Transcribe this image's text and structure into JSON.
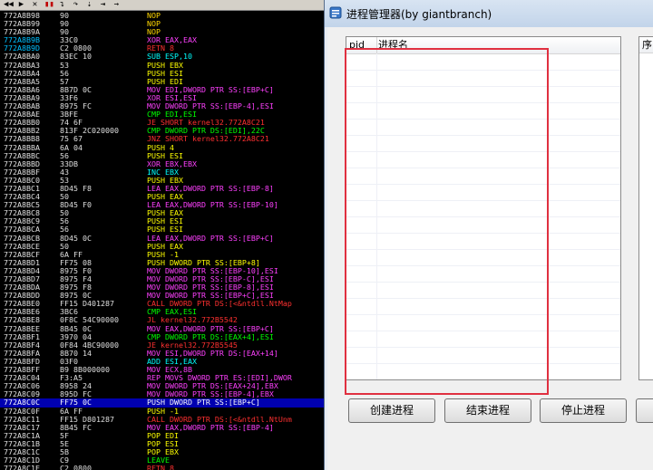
{
  "debugger": {
    "toolbar_icons": [
      "rewind-icon",
      "play-icon",
      "close-icon",
      "pause-icon",
      "step-into-icon",
      "step-over-icon",
      "trace-icon",
      "run-to-icon",
      "goto-icon"
    ],
    "rows": [
      {
        "addr": "772A8B98",
        "hex": "90",
        "asm": "NOP",
        "kind": "nop"
      },
      {
        "addr": "772A8B99",
        "hex": "90",
        "asm": "NOP",
        "kind": "nop"
      },
      {
        "addr": "772A8B9A",
        "hex": "90",
        "asm": "NOP",
        "kind": "nop"
      },
      {
        "addr": "772A8B9B",
        "hex": "33C0",
        "asm": "XOR EAX,EAX",
        "kind": "xor",
        "jmp": true
      },
      {
        "addr": "772A8B9D",
        "hex": "C2 0800",
        "asm": "RETN 8",
        "kind": "ret",
        "jmp": true
      },
      {
        "addr": "772A8BA0",
        "hex": "83EC 10",
        "asm": "SUB ESP,10",
        "kind": "arith"
      },
      {
        "addr": "772A8BA3",
        "hex": "53",
        "asm": "PUSH EBX",
        "kind": "push"
      },
      {
        "addr": "772A8BA4",
        "hex": "56",
        "asm": "PUSH ESI",
        "kind": "push"
      },
      {
        "addr": "772A8BA5",
        "hex": "57",
        "asm": "PUSH EDI",
        "kind": "push"
      },
      {
        "addr": "772A8BA6",
        "hex": "8B7D 0C",
        "asm": "MOV EDI,DWORD PTR SS:[EBP+C]",
        "kind": "mov"
      },
      {
        "addr": "772A8BA9",
        "hex": "33F6",
        "asm": "XOR ESI,ESI",
        "kind": "xor"
      },
      {
        "addr": "772A8BAB",
        "hex": "8975 FC",
        "asm": "MOV DWORD PTR SS:[EBP-4],ESI",
        "kind": "mov"
      },
      {
        "addr": "772A8BAE",
        "hex": "3BFE",
        "asm": "CMP EDI,ESI",
        "kind": "cmp"
      },
      {
        "addr": "772A8BB0",
        "hex": "74 6F",
        "asm": "JE SHORT kernel32.772A8C21",
        "kind": "jmp"
      },
      {
        "addr": "772A8BB2",
        "hex": "813F 2C020000",
        "asm": "CMP DWORD PTR DS:[EDI],22C",
        "kind": "cmp"
      },
      {
        "addr": "772A8BB8",
        "hex": "75 67",
        "asm": "JNZ SHORT kernel32.772A8C21",
        "kind": "jmp"
      },
      {
        "addr": "772A8BBA",
        "hex": "6A 04",
        "asm": "PUSH 4",
        "kind": "push"
      },
      {
        "addr": "772A8BBC",
        "hex": "56",
        "asm": "PUSH ESI",
        "kind": "push"
      },
      {
        "addr": "772A8BBD",
        "hex": "33DB",
        "asm": "XOR EBX,EBX",
        "kind": "xor"
      },
      {
        "addr": "772A8BBF",
        "hex": "43",
        "asm": "INC EBX",
        "kind": "arith"
      },
      {
        "addr": "772A8BC0",
        "hex": "53",
        "asm": "PUSH EBX",
        "kind": "push"
      },
      {
        "addr": "772A8BC1",
        "hex": "8D45 F8",
        "asm": "LEA EAX,DWORD PTR SS:[EBP-8]",
        "kind": "mov"
      },
      {
        "addr": "772A8BC4",
        "hex": "50",
        "asm": "PUSH EAX",
        "kind": "push"
      },
      {
        "addr": "772A8BC5",
        "hex": "8D45 F0",
        "asm": "LEA EAX,DWORD PTR SS:[EBP-10]",
        "kind": "mov"
      },
      {
        "addr": "772A8BC8",
        "hex": "50",
        "asm": "PUSH EAX",
        "kind": "push"
      },
      {
        "addr": "772A8BC9",
        "hex": "56",
        "asm": "PUSH ESI",
        "kind": "push"
      },
      {
        "addr": "772A8BCA",
        "hex": "56",
        "asm": "PUSH ESI",
        "kind": "push"
      },
      {
        "addr": "772A8BCB",
        "hex": "8D45 0C",
        "asm": "LEA EAX,DWORD PTR SS:[EBP+C]",
        "kind": "mov"
      },
      {
        "addr": "772A8BCE",
        "hex": "50",
        "asm": "PUSH EAX",
        "kind": "push"
      },
      {
        "addr": "772A8BCF",
        "hex": "6A FF",
        "asm": "PUSH -1",
        "kind": "push"
      },
      {
        "addr": "772A8BD1",
        "hex": "FF75 08",
        "asm": "PUSH DWORD PTR SS:[EBP+8]",
        "kind": "push"
      },
      {
        "addr": "772A8BD4",
        "hex": "8975 F0",
        "asm": "MOV DWORD PTR SS:[EBP-10],ESI",
        "kind": "mov"
      },
      {
        "addr": "772A8BD7",
        "hex": "8975 F4",
        "asm": "MOV DWORD PTR SS:[EBP-C],ESI",
        "kind": "mov"
      },
      {
        "addr": "772A8BDA",
        "hex": "8975 F8",
        "asm": "MOV DWORD PTR SS:[EBP-8],ESI",
        "kind": "mov"
      },
      {
        "addr": "772A8BDD",
        "hex": "8975 0C",
        "asm": "MOV DWORD PTR SS:[EBP+C],ESI",
        "kind": "mov"
      },
      {
        "addr": "772A8BE0",
        "hex": "FF15 D401287",
        "asm": "CALL DWORD PTR DS:[<&ntdll.NtMap",
        "kind": "call"
      },
      {
        "addr": "772A8BE6",
        "hex": "3BC6",
        "asm": "CMP EAX,ESI",
        "kind": "cmp"
      },
      {
        "addr": "772A8BE8",
        "hex": "0F8C 54C90000",
        "asm": "JL kernel32.772B5542",
        "kind": "jmp"
      },
      {
        "addr": "772A8BEE",
        "hex": "8B45 0C",
        "asm": "MOV EAX,DWORD PTR SS:[EBP+C]",
        "kind": "mov"
      },
      {
        "addr": "772A8BF1",
        "hex": "3970 04",
        "asm": "CMP DWORD PTR DS:[EAX+4],ESI",
        "kind": "cmp"
      },
      {
        "addr": "772A8BF4",
        "hex": "0F84 4BC90000",
        "asm": "JE kernel32.772B5545",
        "kind": "jmp"
      },
      {
        "addr": "772A8BFA",
        "hex": "8B70 14",
        "asm": "MOV ESI,DWORD PTR DS:[EAX+14]",
        "kind": "mov"
      },
      {
        "addr": "772A8BFD",
        "hex": "03F0",
        "asm": "ADD ESI,EAX",
        "kind": "arith"
      },
      {
        "addr": "772A8BFF",
        "hex": "B9 8B000000",
        "asm": "MOV ECX,8B",
        "kind": "mov"
      },
      {
        "addr": "772A8C04",
        "hex": "F3:A5",
        "asm": "REP MOVS DWORD PTR ES:[EDI],DWOR",
        "kind": "mov"
      },
      {
        "addr": "772A8C06",
        "hex": "8958 24",
        "asm": "MOV DWORD PTR DS:[EAX+24],EBX",
        "kind": "mov"
      },
      {
        "addr": "772A8C09",
        "hex": "895D FC",
        "asm": "MOV DWORD PTR SS:[EBP-4],EBX",
        "kind": "mov"
      },
      {
        "addr": "772A8C0C",
        "hex": "FF75 0C",
        "asm": "PUSH DWORD PTR SS:[EBP+C]",
        "kind": "push",
        "highlight": true
      },
      {
        "addr": "772A8C0F",
        "hex": "6A FF",
        "asm": "PUSH -1",
        "kind": "push"
      },
      {
        "addr": "772A8C11",
        "hex": "FF15 D801287",
        "asm": "CALL DWORD PTR DS:[<&ntdll.NtUnm",
        "kind": "call"
      },
      {
        "addr": "772A8C17",
        "hex": "8B45 FC",
        "asm": "MOV EAX,DWORD PTR SS:[EBP-4]",
        "kind": "mov"
      },
      {
        "addr": "772A8C1A",
        "hex": "5F",
        "asm": "POP EDI",
        "kind": "pop"
      },
      {
        "addr": "772A8C1B",
        "hex": "5E",
        "asm": "POP ESI",
        "kind": "pop"
      },
      {
        "addr": "772A8C1C",
        "hex": "5B",
        "asm": "POP EBX",
        "kind": "pop"
      },
      {
        "addr": "772A8C1D",
        "hex": "C9",
        "asm": "LEAVE",
        "kind": "cmp"
      },
      {
        "addr": "772A8C1E",
        "hex": "C2 0800",
        "asm": "RETN 8",
        "kind": "ret"
      }
    ]
  },
  "process_manager": {
    "title": "进程管理器(by giantbranch)",
    "list": {
      "col_pid": "pid",
      "col_name": "进程名",
      "right_col": "序"
    },
    "buttons": {
      "create": "创建进程",
      "end": "结束进程",
      "stop": "停止进程"
    },
    "colors": {
      "annotation": "#e03040",
      "highlight_row": "#0000b0"
    }
  }
}
